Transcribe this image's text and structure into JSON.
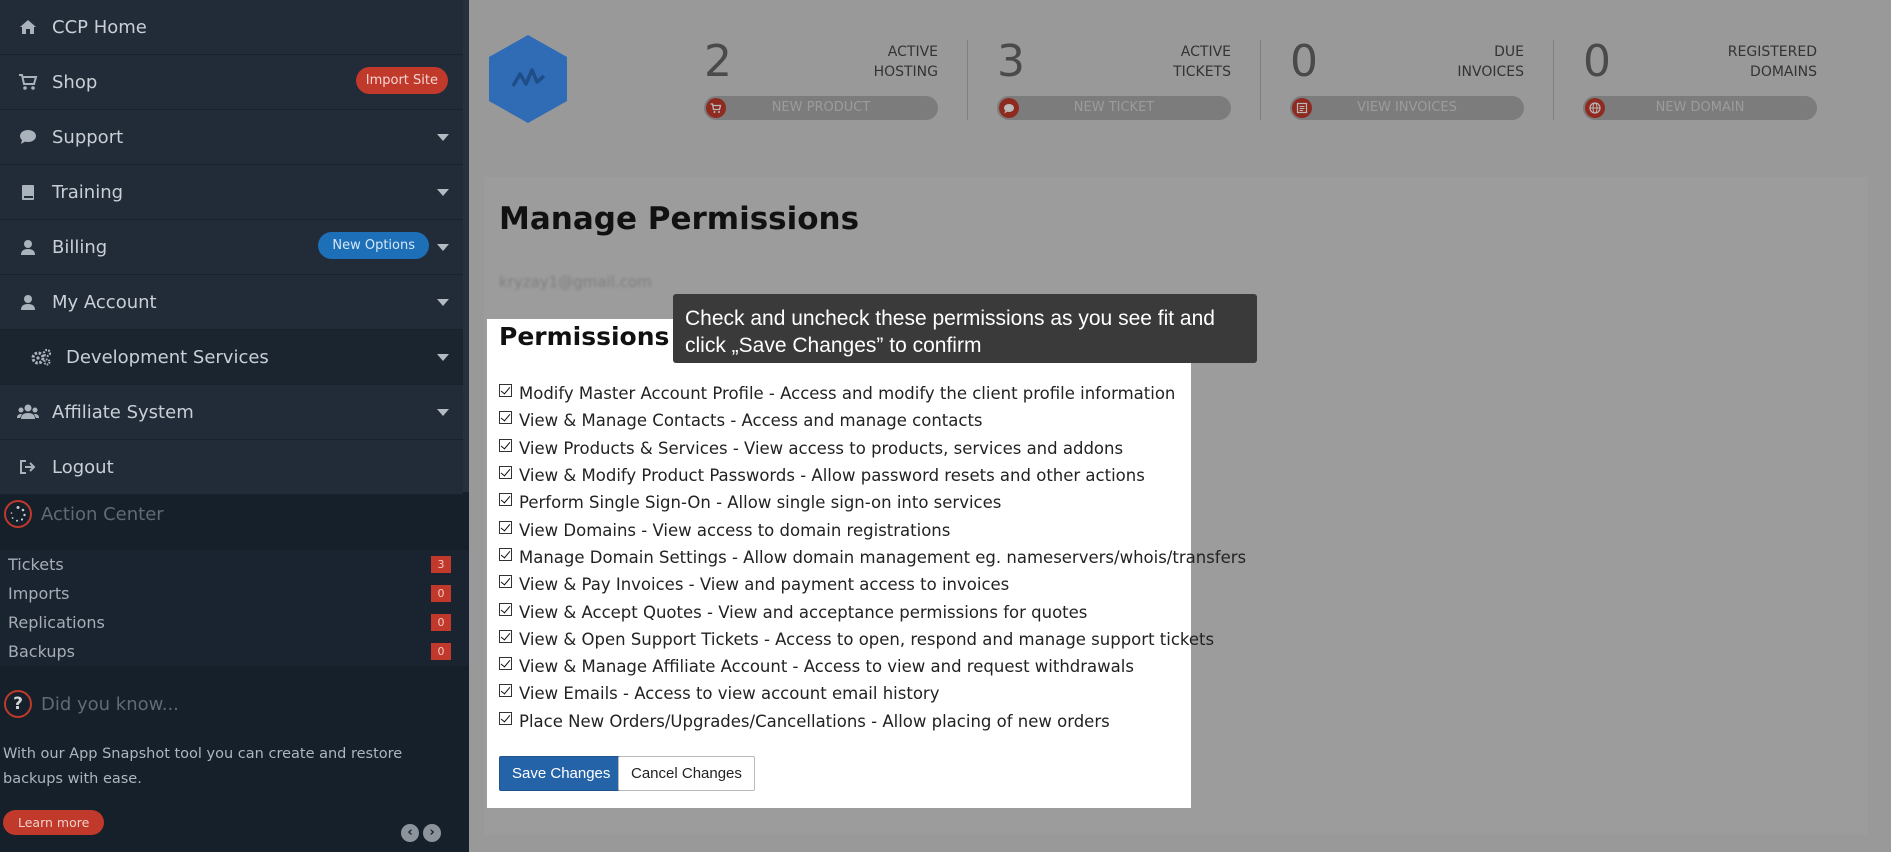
{
  "sidebar": {
    "items": [
      {
        "label": "CCP Home",
        "icon": "home-icon"
      },
      {
        "label": "Shop",
        "icon": "cart-icon",
        "badge": "Import Site"
      },
      {
        "label": "Support",
        "icon": "chat-icon"
      },
      {
        "label": "Training",
        "icon": "book-icon"
      },
      {
        "label": "Billing",
        "icon": "user-icon",
        "badge": "New Options"
      },
      {
        "label": "My Account",
        "icon": "user-icon"
      },
      {
        "label": "Development Services",
        "icon": "gears-icon"
      },
      {
        "label": "Affiliate System",
        "icon": "users-icon"
      },
      {
        "label": "Logout",
        "icon": "logout-icon"
      }
    ],
    "action_center": {
      "title": "Action Center",
      "rows": [
        {
          "label": "Tickets",
          "count": "3"
        },
        {
          "label": "Imports",
          "count": "0"
        },
        {
          "label": "Replications",
          "count": "0"
        },
        {
          "label": "Backups",
          "count": "0"
        }
      ]
    },
    "did_you_know": {
      "title": "Did you know...",
      "text": "With our App Snapshot tool you can create and restore backups with ease.",
      "learn_more": "Learn more",
      "prev": "‹",
      "next": "›"
    }
  },
  "stats": [
    {
      "number": "2",
      "caption_line1": "ACTIVE",
      "caption_line2": "HOSTING",
      "action": "NEW PRODUCT",
      "icon": "cart-icon"
    },
    {
      "number": "3",
      "caption_line1": "ACTIVE",
      "caption_line2": "TICKETS",
      "action": "NEW TICKET",
      "icon": "chat-icon"
    },
    {
      "number": "0",
      "caption_line1": "DUE",
      "caption_line2": "INVOICES",
      "action": "VIEW INVOICES",
      "icon": "invoice-icon"
    },
    {
      "number": "0",
      "caption_line1": "REGISTERED",
      "caption_line2": "DOMAINS",
      "action": "NEW DOMAIN",
      "icon": "globe-icon"
    }
  ],
  "main": {
    "title": "Manage Permissions",
    "email": "kryzay1@gmail.com",
    "permissions": {
      "title": "Permissions",
      "items": [
        "Modify Master Account Profile - Access and modify the client profile information",
        "View & Manage Contacts - Access and manage contacts",
        "View Products & Services - View access to products, services and addons",
        "View & Modify Product Passwords - Allow password resets and other actions",
        "Perform Single Sign-On - Allow single sign-on into services",
        "View Domains - View access to domain registrations",
        "Manage Domain Settings - Allow domain management eg. nameservers/whois/transfers",
        "View & Pay Invoices - View and payment access to invoices",
        "View & Accept Quotes - View and acceptance permissions for quotes",
        "View & Open Support Tickets - Access to open, respond and manage support tickets",
        "View & Manage Affiliate Account - Access to view and request withdrawals",
        "View Emails - Access to view account email history",
        "Place New Orders/Upgrades/Cancellations - Allow placing of new orders"
      ],
      "save_label": "Save Changes",
      "cancel_label": "Cancel Changes"
    },
    "tooltip": {
      "line1": "Check and uncheck these permissions as you see fit and",
      "line2": "click „Save Changes” to confirm"
    }
  },
  "colors": {
    "sidebar_bg": "#15202b",
    "nav_item_bg": "#222c38",
    "accent_red": "#c0392b",
    "accent_blue": "#1d6fb8",
    "primary_button": "#2563a8",
    "logo_blue": "#2f6cb5"
  }
}
